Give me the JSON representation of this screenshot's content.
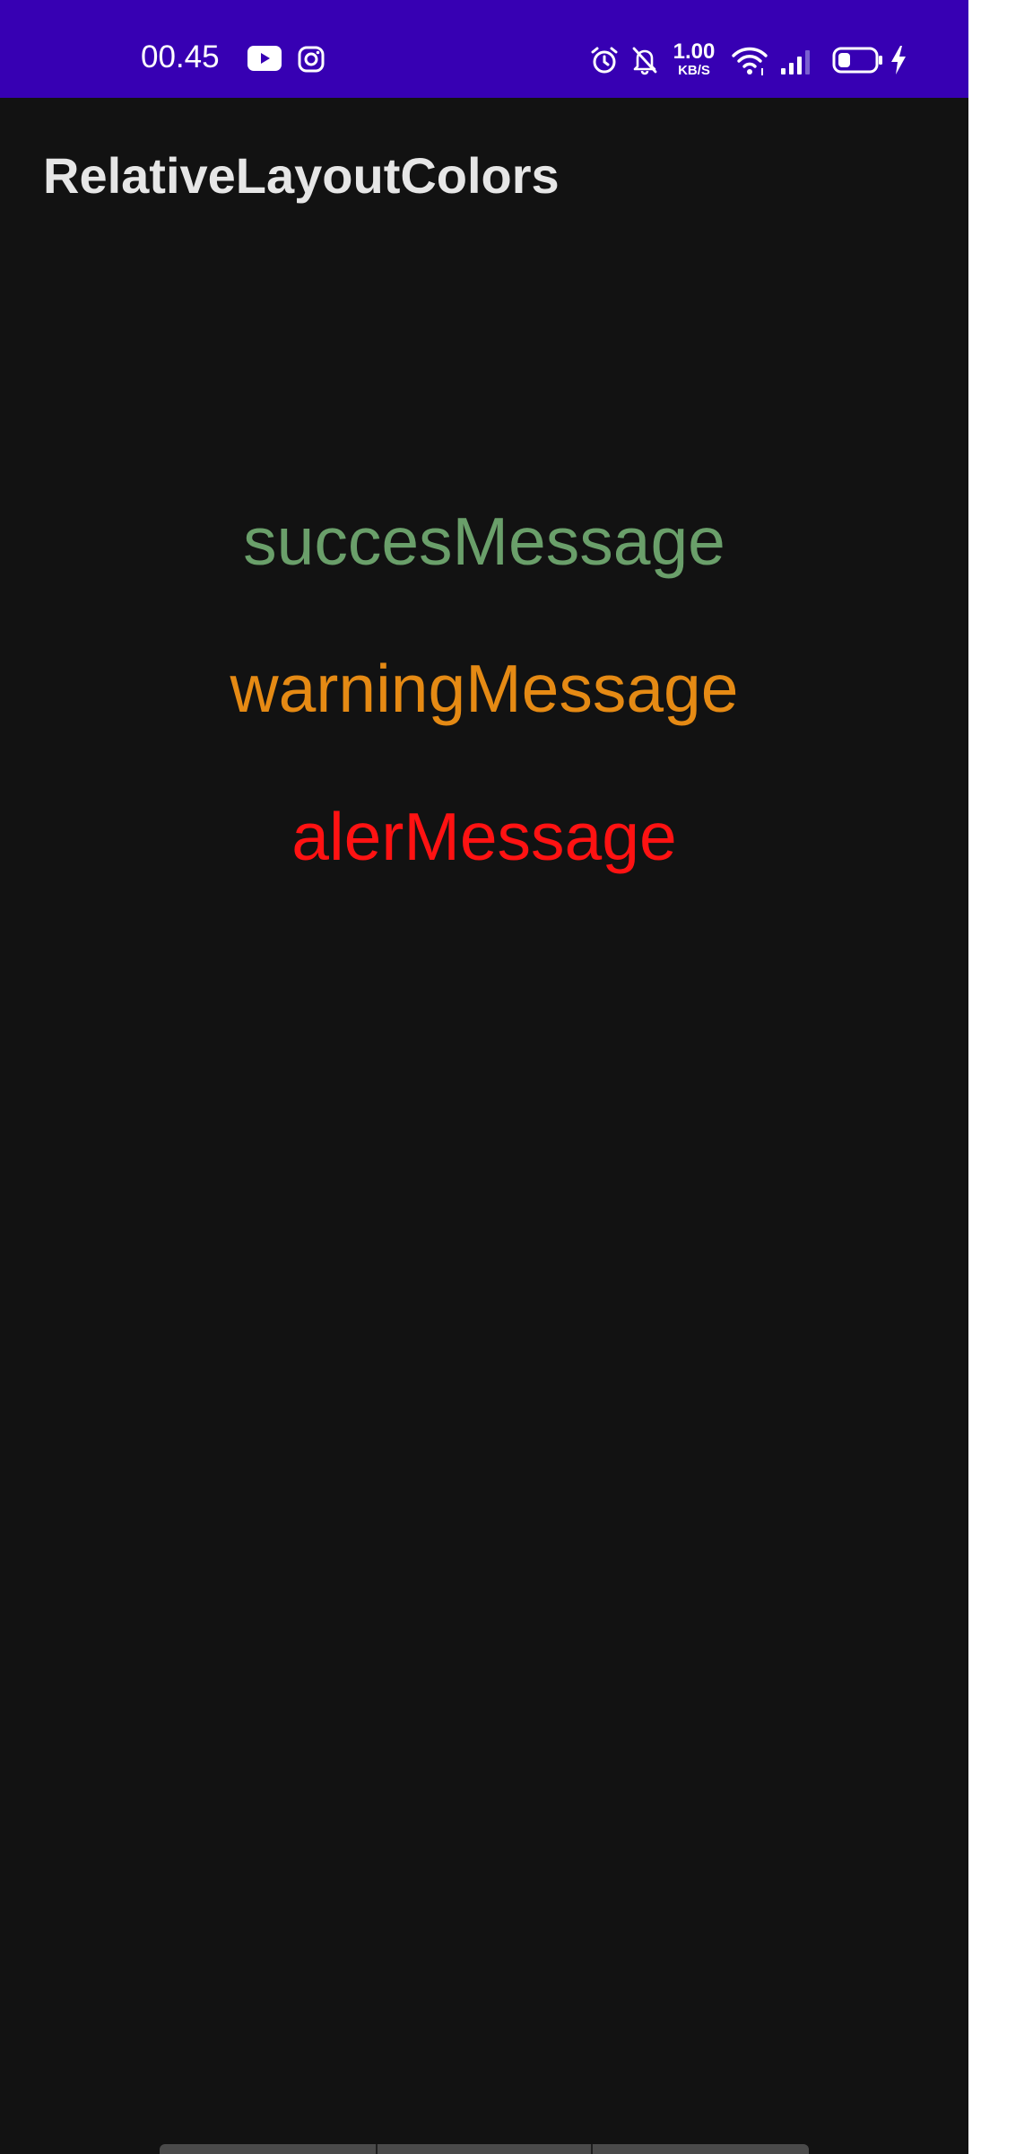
{
  "status_bar": {
    "time": "00.45",
    "net_speed_value": "1.00",
    "net_speed_unit": "KB/S",
    "background_color": "#3700B3",
    "left_icons": [
      "youtube-icon",
      "instagram-icon"
    ],
    "right_icons": [
      "alarm-icon",
      "bell-off-icon",
      "wifi-icon",
      "signal-icon",
      "battery-icon",
      "charging-icon"
    ],
    "battery_level": 0.3
  },
  "app_bar": {
    "title": "RelativeLayoutColors"
  },
  "messages": {
    "success": {
      "text": "succesMessage",
      "color": "#6a9f6a"
    },
    "warning": {
      "text": "warningMessage",
      "color": "#e58a14"
    },
    "alert": {
      "text": "alerMessage",
      "color": "#ff1212"
    }
  },
  "theme": {
    "background": "#121212",
    "title_color": "#e6e6e6"
  }
}
